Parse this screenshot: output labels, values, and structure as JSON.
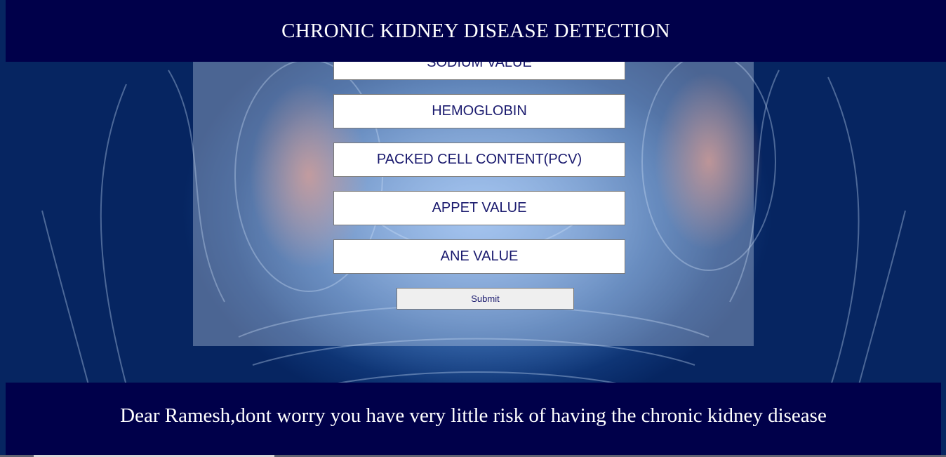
{
  "header": {
    "title": "CHRONIC KIDNEY DISEASE DETECTION"
  },
  "form": {
    "fields": [
      {
        "placeholder": "SODIUM VALUE"
      },
      {
        "placeholder": "HEMOGLOBIN"
      },
      {
        "placeholder": "PACKED CELL CONTENT(PCV)"
      },
      {
        "placeholder": "APPET VALUE"
      },
      {
        "placeholder": "ANE VALUE"
      }
    ],
    "submit_label": "Submit"
  },
  "result": {
    "message": "Dear Ramesh,dont worry you have very little risk of having the chronic kidney disease"
  },
  "colors": {
    "banner": "#00004a",
    "field_text": "#1a1a6e"
  }
}
